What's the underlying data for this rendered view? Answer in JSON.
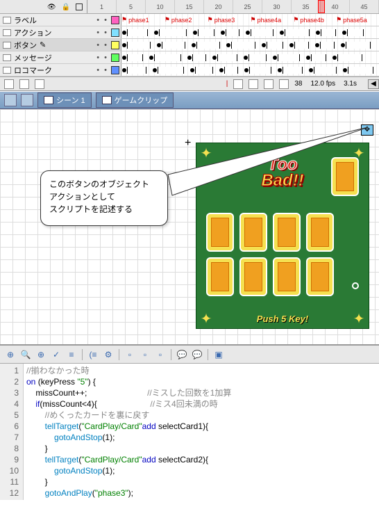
{
  "timeline": {
    "ruler": [
      "1",
      "5",
      "10",
      "15",
      "20",
      "25",
      "30",
      "35",
      "40",
      "45"
    ],
    "playhead_at_tick_index": 8,
    "layers": [
      {
        "name": "ラベル",
        "swatch": "#ff60c0",
        "phases": [
          "phase1",
          "phase2",
          "phase3",
          "phase4a",
          "phase4b",
          "phase5a"
        ],
        "dots": "• •"
      },
      {
        "name": "アクション",
        "swatch": "#80e0ff",
        "dots": "• •"
      },
      {
        "name": "ボタン",
        "swatch": "#ffff60",
        "dots": "• •",
        "selected": true,
        "pencil": true
      },
      {
        "name": "メッセージ",
        "swatch": "#60ff60",
        "dots": "• •"
      },
      {
        "name": "ロコマーク",
        "swatch": "#6090ff",
        "dots": "• •",
        "cut": true
      }
    ],
    "footer": {
      "frame": "38",
      "fps": "12.0 fps",
      "time": "3.1s"
    }
  },
  "breadcrumb": {
    "scene": "シーン 1",
    "clip": "ゲームクリップ"
  },
  "callout": {
    "line1": "このボタンのオブジェクト",
    "line2": "アクションとして",
    "line3": "スクリプトを記述する"
  },
  "board": {
    "title_line1": "Too",
    "title_line2": "Bad!!",
    "push": "Push 5 Key!"
  },
  "actions": {
    "lines": [
      {
        "n": "1",
        "html": "<span class='c-com'>//揃わなかった時</span>"
      },
      {
        "n": "2",
        "html": "<span class='c-kw'>on</span> (keyPress <span class='c-str'>\"5\"</span>) {"
      },
      {
        "n": "3",
        "html": "    missCount++;                          <span class='c-com'>//ミスした回数を1加算</span>"
      },
      {
        "n": "4",
        "html": "    <span class='c-kw'>if</span>(missCount&lt;4){                       <span class='c-com'>//ミス4回未満の時</span>"
      },
      {
        "n": "5",
        "html": "        <span class='c-com'>//めくったカードを裏に戻す</span>"
      },
      {
        "n": "6",
        "html": "        <span class='c-fn'>tellTarget</span>(<span class='c-str'>\"CardPlay/Card\"</span><span class='c-kw'>add</span> selectCard1){"
      },
      {
        "n": "7",
        "html": "            <span class='c-fn'>gotoAndStop</span>(1);"
      },
      {
        "n": "8",
        "html": "        }"
      },
      {
        "n": "9",
        "html": "        <span class='c-fn'>tellTarget</span>(<span class='c-str'>\"CardPlay/Card\"</span><span class='c-kw'>add</span> selectCard2){"
      },
      {
        "n": "10",
        "html": "            <span class='c-fn'>gotoAndStop</span>(1);"
      },
      {
        "n": "11",
        "html": "        }"
      },
      {
        "n": "12",
        "html": "        <span class='c-fn'>gotoAndPlay</span>(<span class='c-str'>\"phase3\"</span>);"
      }
    ]
  }
}
